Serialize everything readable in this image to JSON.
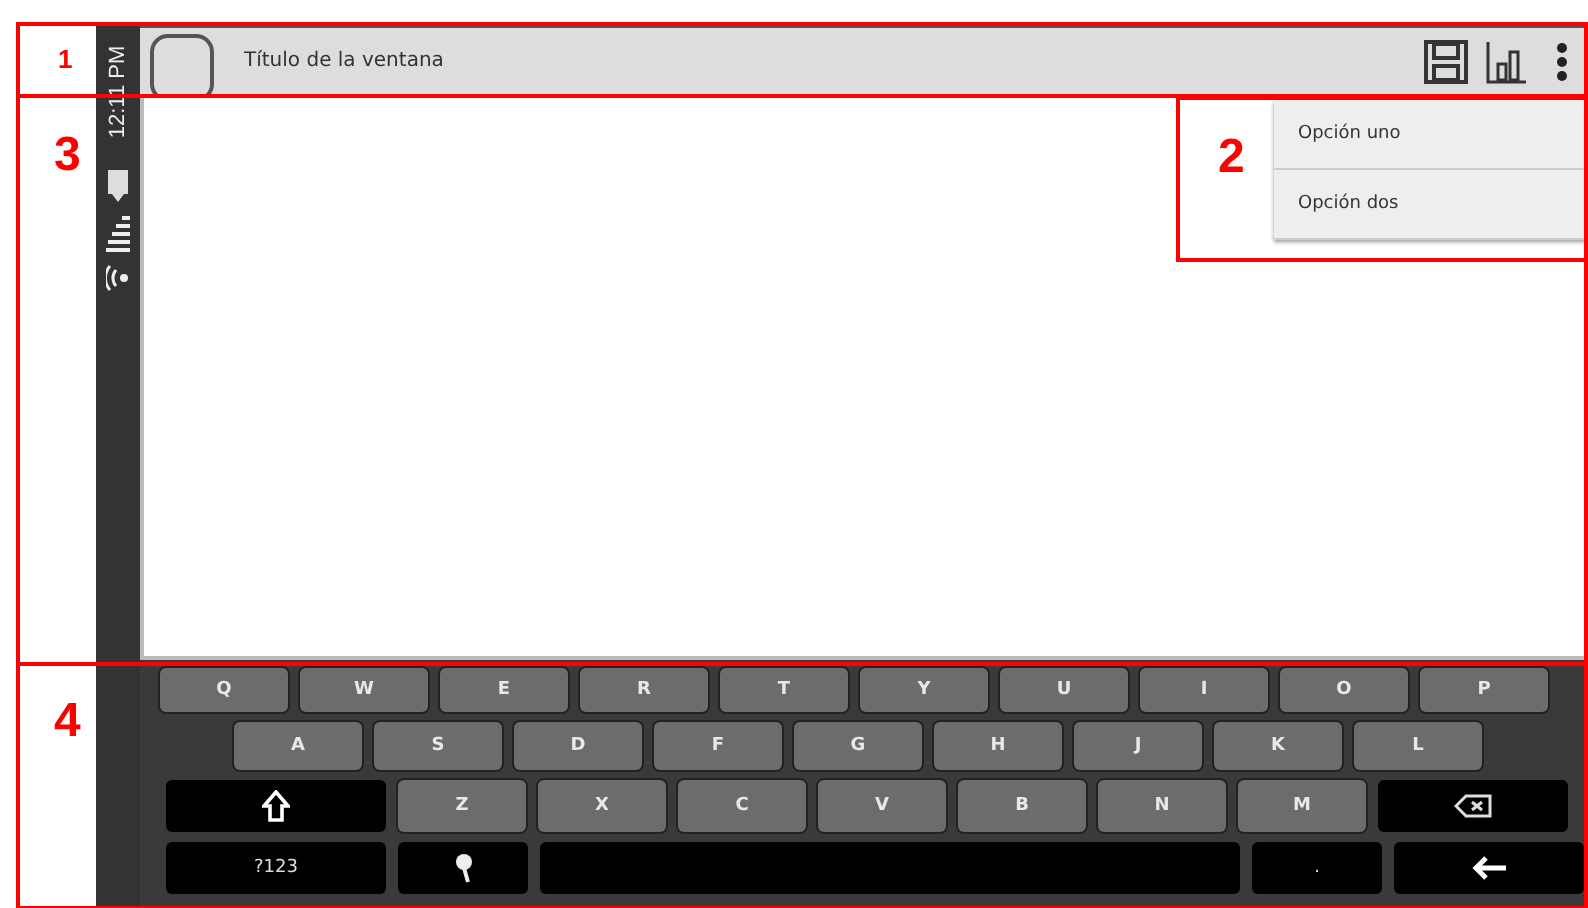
{
  "status_bar": {
    "time": "12:11 PM"
  },
  "action_bar": {
    "title": "Título de la ventana"
  },
  "overflow_menu": {
    "items": [
      {
        "label": "Opción uno"
      },
      {
        "label": "Opción dos"
      }
    ]
  },
  "keyboard": {
    "rows": [
      [
        {
          "kind": "char",
          "label": "Q"
        },
        {
          "kind": "char",
          "label": "W"
        },
        {
          "kind": "char",
          "label": "E"
        },
        {
          "kind": "char",
          "label": "R"
        },
        {
          "kind": "char",
          "label": "T"
        },
        {
          "kind": "char",
          "label": "Y"
        },
        {
          "kind": "char",
          "label": "U"
        },
        {
          "kind": "char",
          "label": "I"
        },
        {
          "kind": "char",
          "label": "O"
        },
        {
          "kind": "char",
          "label": "P"
        }
      ],
      [
        {
          "kind": "char",
          "label": "A"
        },
        {
          "kind": "char",
          "label": "S"
        },
        {
          "kind": "char",
          "label": "D"
        },
        {
          "kind": "char",
          "label": "F"
        },
        {
          "kind": "char",
          "label": "G"
        },
        {
          "kind": "char",
          "label": "H"
        },
        {
          "kind": "char",
          "label": "J"
        },
        {
          "kind": "char",
          "label": "K"
        },
        {
          "kind": "char",
          "label": "L"
        }
      ],
      [
        {
          "kind": "shift"
        },
        {
          "kind": "char",
          "label": "Z"
        },
        {
          "kind": "char",
          "label": "X"
        },
        {
          "kind": "char",
          "label": "C"
        },
        {
          "kind": "char",
          "label": "V"
        },
        {
          "kind": "char",
          "label": "B"
        },
        {
          "kind": "char",
          "label": "N"
        },
        {
          "kind": "char",
          "label": "M"
        },
        {
          "kind": "backspace"
        }
      ],
      [
        {
          "kind": "symbols",
          "label": "?123"
        },
        {
          "kind": "mic"
        },
        {
          "kind": "space"
        },
        {
          "kind": "period",
          "label": "."
        },
        {
          "kind": "enter"
        }
      ]
    ]
  },
  "annotations": [
    {
      "label": "1"
    },
    {
      "label": "3"
    },
    {
      "label": "2"
    },
    {
      "label": "4"
    }
  ]
}
